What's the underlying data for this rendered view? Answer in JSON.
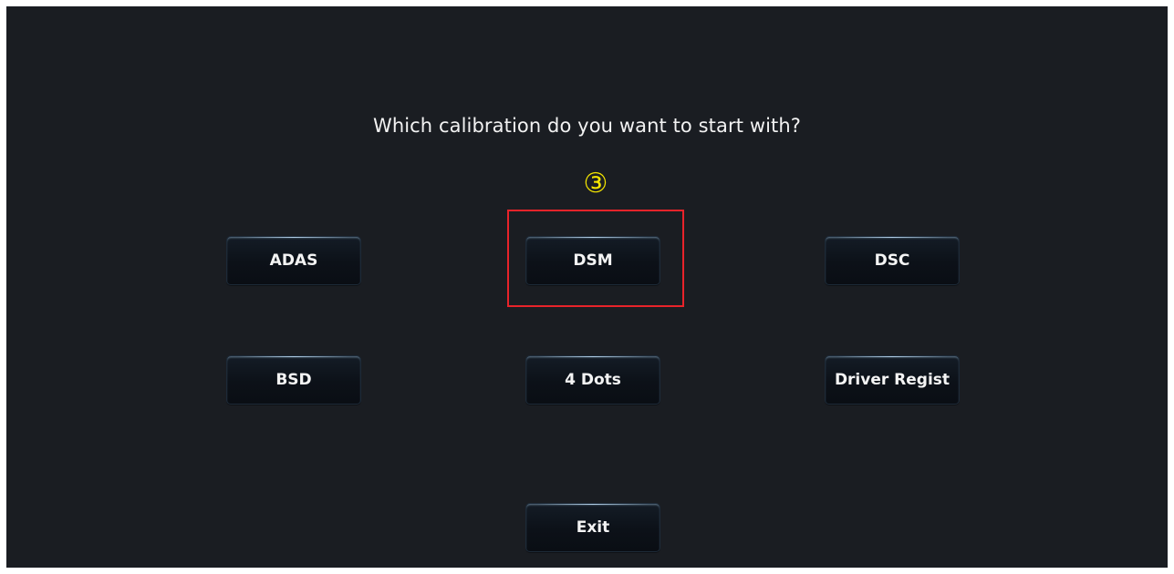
{
  "prompt": "Which calibration do you want to start with?",
  "annotation": {
    "step_marker": "③",
    "highlight_color": "#e8232a",
    "marker_color": "#f5e600"
  },
  "buttons": {
    "adas": "ADAS",
    "dsm": "DSM",
    "dsc": "DSC",
    "bsd": "BSD",
    "four_dots": "4 Dots",
    "driver_regist": "Driver Regist",
    "exit": "Exit"
  },
  "colors": {
    "background": "#1a1d22",
    "button_fill": "#0c1118",
    "button_edge_glow": "#bedcf5",
    "text": "#f4f4f4"
  }
}
